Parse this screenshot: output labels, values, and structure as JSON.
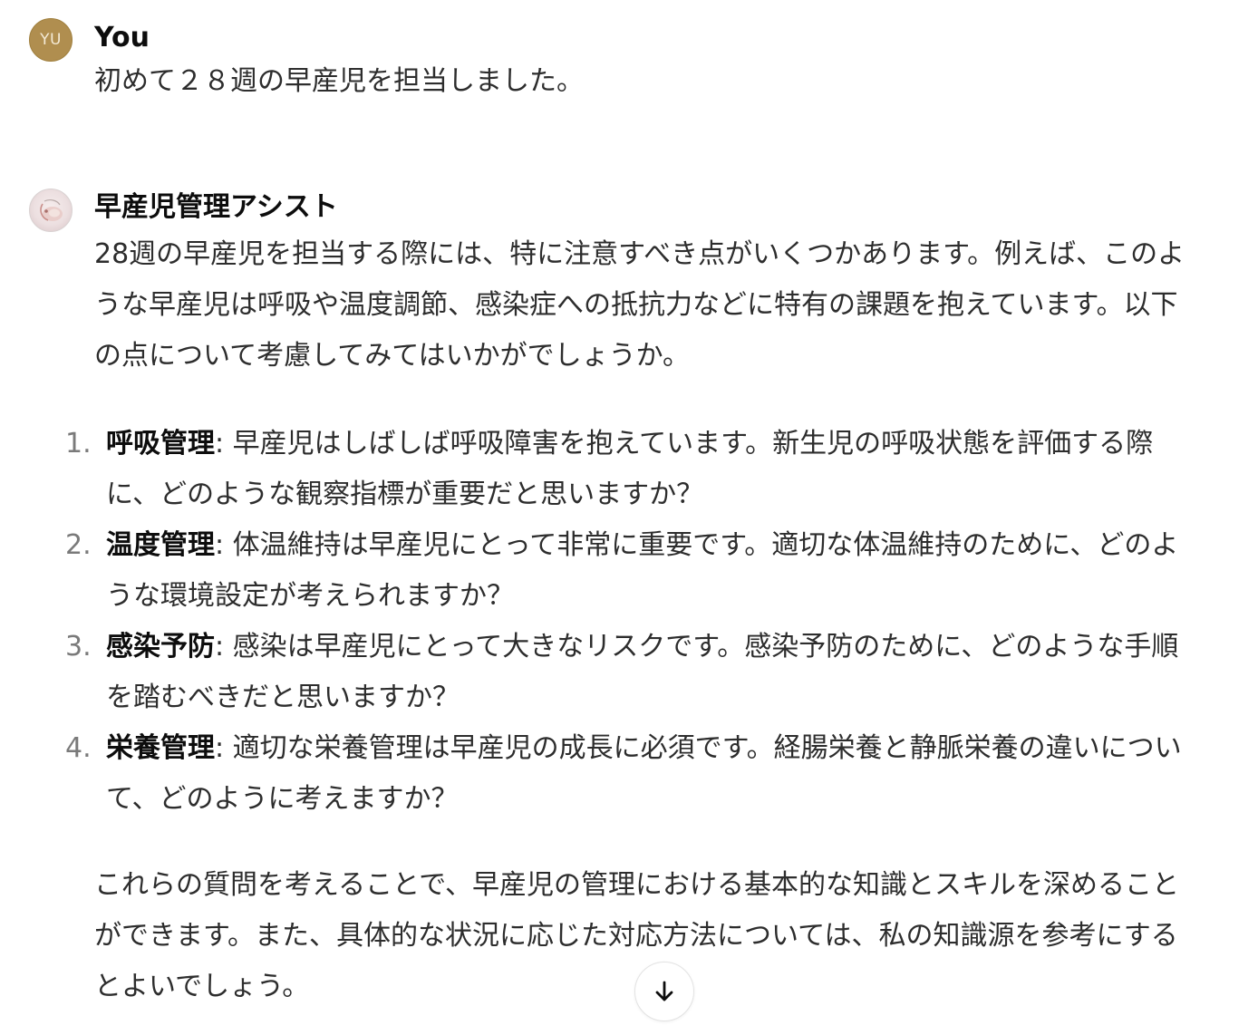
{
  "conversation": {
    "user_message": {
      "avatar_initials": "YU",
      "author": "You",
      "text": "初めて２８週の早産児を担当しました。"
    },
    "assistant_message": {
      "avatar_icon": "gpt-avatar-icon",
      "author": "早産児管理アシスト",
      "intro": "28週の早産児を担当する際には、特に注意すべき点がいくつかあります。例えば、このような早産児は呼吸や温度調節、感染症への抵抗力などに特有の課題を抱えています。以下の点について考慮してみてはいかがでしょうか。",
      "items": [
        {
          "number": "1.",
          "term": "呼吸管理",
          "body": ": 早産児はしばしば呼吸障害を抱えています。新生児の呼吸状態を評価する際に、どのような観察指標が重要だと思いますか？"
        },
        {
          "number": "2.",
          "term": "温度管理",
          "body": ": 体温維持は早産児にとって非常に重要です。適切な体温維持のために、どのような環境設定が考えられますか？"
        },
        {
          "number": "3.",
          "term": "感染予防",
          "body": ": 感染は早産児にとって大きなリスクです。感染予防のために、どのような手順を踏むべきだと思いますか？"
        },
        {
          "number": "4.",
          "term": "栄養管理",
          "body": ": 適切な栄養管理は早産児の成長に必須です。経腸栄養と静脈栄養の違いについて、どのように考えますか？"
        }
      ],
      "outro": "これらの質問を考えることで、早産児の管理における基本的な知識とスキルを深めることができます。また、具体的な状況に応じた対応方法については、私の知識源を参考にするとよいでしょう。"
    }
  },
  "controls": {
    "scroll_down_icon": "arrow-down-icon"
  },
  "colors": {
    "user_avatar": "#b08e4f",
    "text": "#2d2d2d",
    "heading": "#0d0d0d",
    "list_number": "#7a7a7a"
  }
}
